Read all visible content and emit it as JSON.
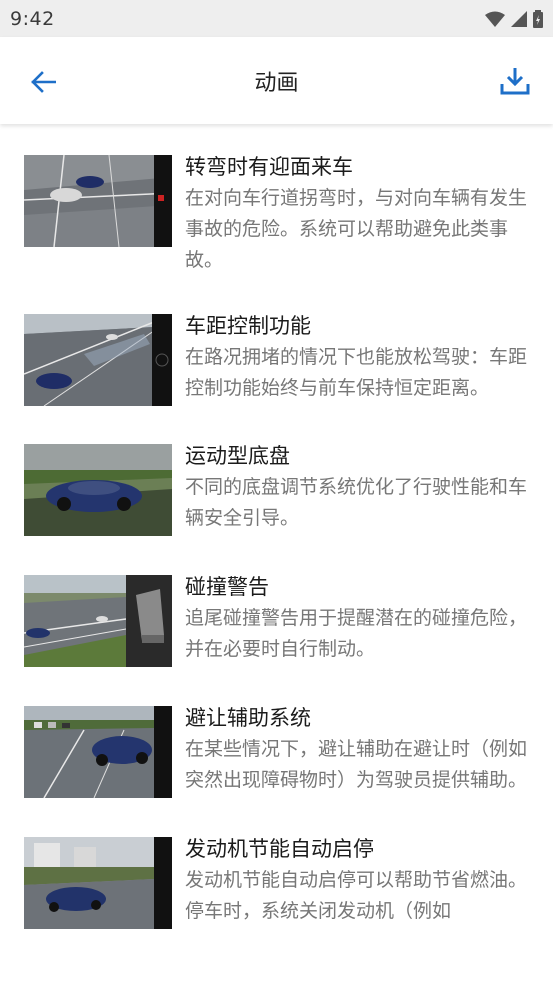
{
  "status_bar": {
    "time": "9:42"
  },
  "appbar": {
    "title": "动画"
  },
  "items": [
    {
      "title": "转弯时有迎面来车",
      "desc": "在对向车行道拐弯时，与对向车辆有发生事故的危险。系统可以帮助避免此类事故。"
    },
    {
      "title": "车距控制功能",
      "desc": "在路况拥堵的情况下也能放松驾驶：车距控制功能始终与前车保持恒定距离。"
    },
    {
      "title": "运动型底盘",
      "desc": "不同的底盘调节系统优化了行驶性能和车辆安全引导。"
    },
    {
      "title": "碰撞警告",
      "desc": "追尾碰撞警告用于提醒潜在的碰撞危险，并在必要时自行制动。"
    },
    {
      "title": "避让辅助系统",
      "desc": "在某些情况下，避让辅助在避让时（例如突然出现障碍物时）为驾驶员提供辅助。"
    },
    {
      "title": "发动机节能自动启停",
      "desc": "发动机节能自动启停可以帮助节省燃油。停车时，系统关闭发动机（例如"
    }
  ],
  "colors": {
    "accent": "#1e6fc8",
    "status_bg": "#eeeeee"
  }
}
